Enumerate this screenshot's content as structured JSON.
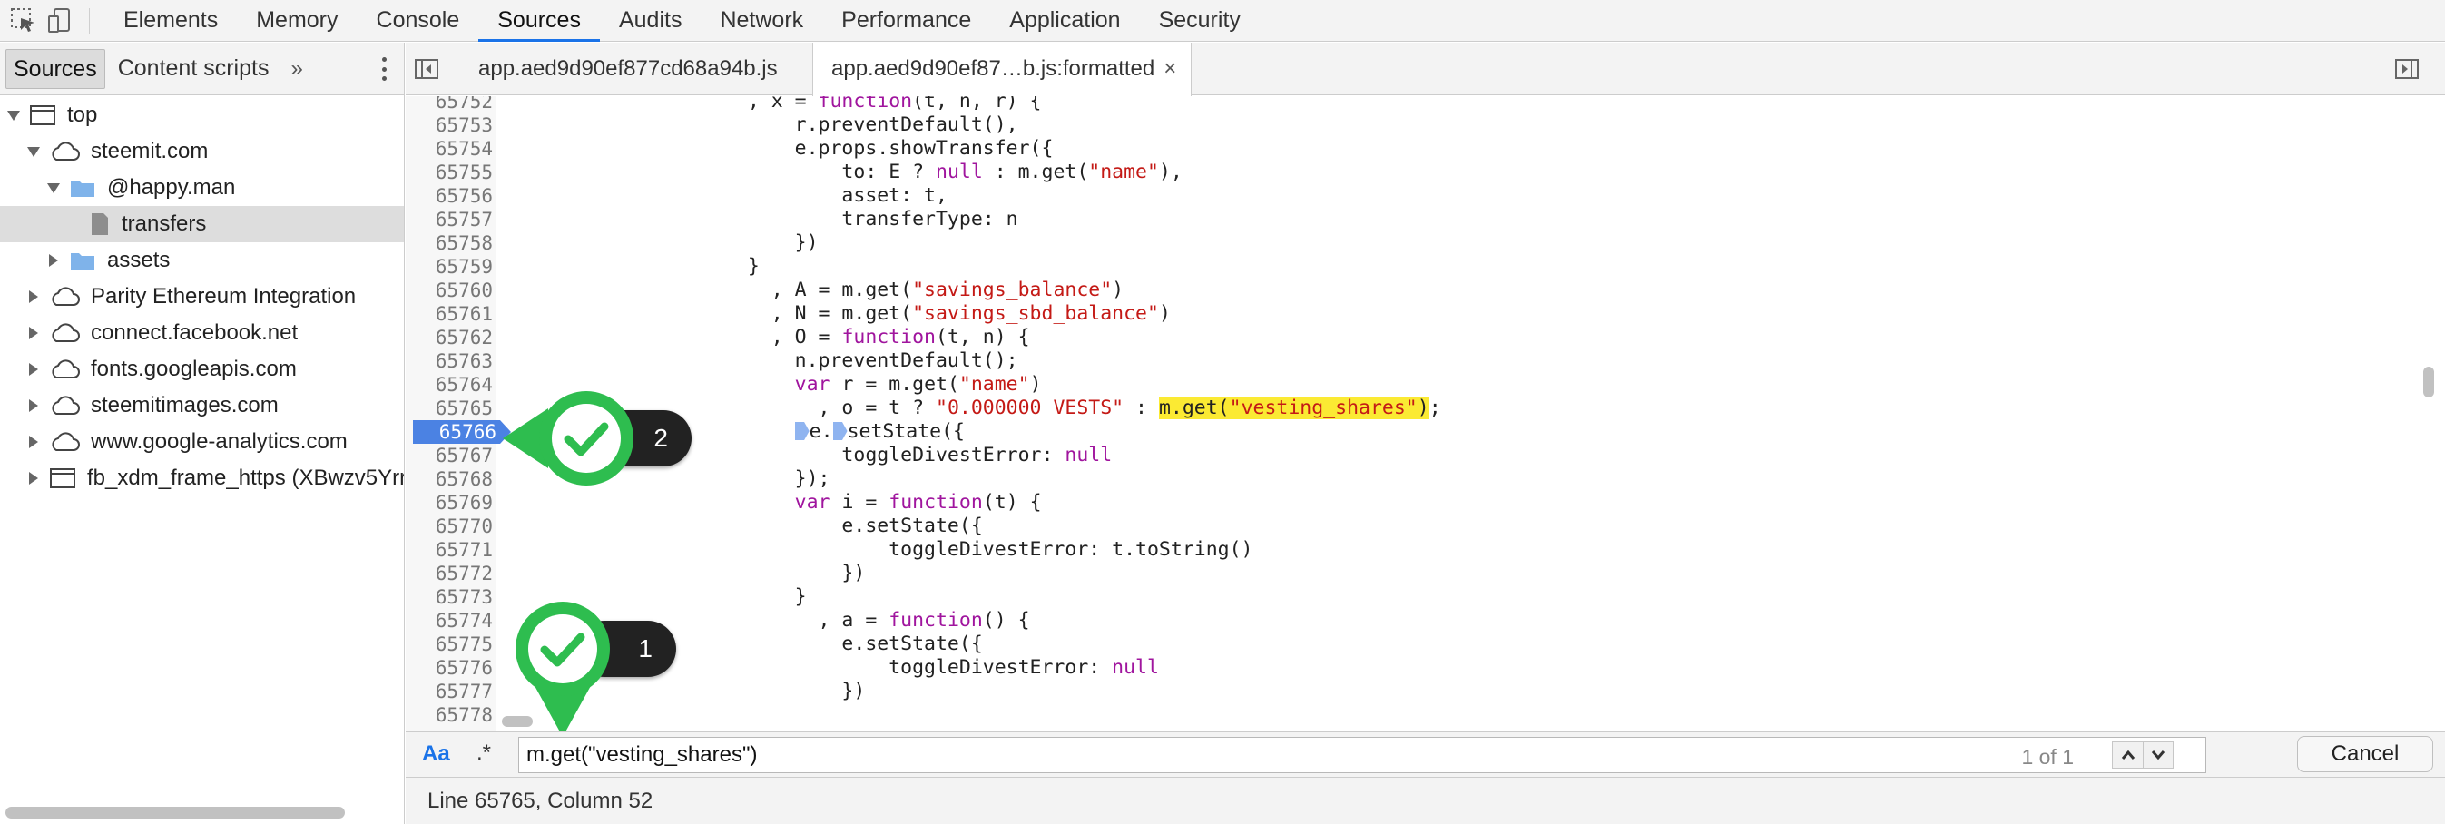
{
  "toolbar": {
    "icons": [
      "inspect-element-icon",
      "device-toggle-icon"
    ],
    "tabs": [
      "Elements",
      "Memory",
      "Console",
      "Sources",
      "Audits",
      "Network",
      "Performance",
      "Application",
      "Security"
    ],
    "active_tab": "Sources"
  },
  "navigator": {
    "tabs": [
      "Sources",
      "Content scripts"
    ],
    "active_tab": "Sources",
    "more": "»",
    "tree": [
      {
        "label": "top",
        "depth": 0,
        "expanded": true,
        "icon": "frame-icon"
      },
      {
        "label": "steemit.com",
        "depth": 1,
        "expanded": true,
        "icon": "cloud-icon"
      },
      {
        "label": "@happy.man",
        "depth": 2,
        "expanded": true,
        "icon": "folder-icon"
      },
      {
        "label": "transfers",
        "depth": 3,
        "icon": "file-icon",
        "selected": true
      },
      {
        "label": "assets",
        "depth": 2,
        "expanded": false,
        "icon": "folder-icon"
      },
      {
        "label": "Parity Ethereum Integration",
        "depth": 1,
        "expanded": false,
        "icon": "cloud-icon"
      },
      {
        "label": "connect.facebook.net",
        "depth": 1,
        "expanded": false,
        "icon": "cloud-icon"
      },
      {
        "label": "fonts.googleapis.com",
        "depth": 1,
        "expanded": false,
        "icon": "cloud-icon"
      },
      {
        "label": "steemitimages.com",
        "depth": 1,
        "expanded": false,
        "icon": "cloud-icon"
      },
      {
        "label": "www.google-analytics.com",
        "depth": 1,
        "expanded": false,
        "icon": "cloud-icon"
      },
      {
        "label": "fb_xdm_frame_https (XBwzv5Yrr",
        "depth": 1,
        "expanded": false,
        "icon": "frame-icon"
      }
    ]
  },
  "editor": {
    "tabs": [
      "app.aed9d90ef877cd68a94b.js",
      "app.aed9d90ef87…b.js:formatted"
    ],
    "active_tab": "app.aed9d90ef87…b.js:formatted",
    "close_symbol": "×",
    "line_numbers": [
      "65752",
      "65753",
      "65754",
      "65755",
      "65756",
      "65757",
      "65758",
      "65759",
      "65760",
      "65761",
      "65762",
      "65763",
      "65764",
      "65765",
      "65766",
      "65767",
      "65768",
      "65769",
      "65770",
      "65771",
      "65772",
      "65773",
      "65774",
      "65775",
      "65776",
      "65777",
      "65778"
    ],
    "breakpoint_line": "65766",
    "code_lines": [
      [
        {
          "t": "                    , x = "
        },
        {
          "t": "function",
          "c": "k"
        },
        {
          "t": "(t, n, r) {"
        }
      ],
      [
        {
          "t": "                        r.preventDefault(),"
        }
      ],
      [
        {
          "t": "                        e.props.showTransfer({"
        }
      ],
      [
        {
          "t": "                            to: E ? "
        },
        {
          "t": "null",
          "c": "k"
        },
        {
          "t": " : m.get("
        },
        {
          "t": "\"name\"",
          "c": "s"
        },
        {
          "t": "),"
        }
      ],
      [
        {
          "t": "                            asset: t,"
        }
      ],
      [
        {
          "t": "                            transferType: n"
        }
      ],
      [
        {
          "t": "                        })"
        }
      ],
      [
        {
          "t": "                    }"
        }
      ],
      [
        {
          "t": "                      , A = m.get("
        },
        {
          "t": "\"savings_balance\"",
          "c": "s"
        },
        {
          "t": ")"
        }
      ],
      [
        {
          "t": "                      , N = m.get("
        },
        {
          "t": "\"savings_sbd_balance\"",
          "c": "s"
        },
        {
          "t": ")"
        }
      ],
      [
        {
          "t": "                      , O = "
        },
        {
          "t": "function",
          "c": "k"
        },
        {
          "t": "(t, n) {"
        }
      ],
      [
        {
          "t": "                        n.preventDefault();"
        }
      ],
      [
        {
          "t": "                        "
        },
        {
          "t": "var",
          "c": "k"
        },
        {
          "t": " r = m.get("
        },
        {
          "t": "\"name\"",
          "c": "s"
        },
        {
          "t": ")"
        }
      ],
      [
        {
          "t": "                          , o = t ? "
        },
        {
          "t": "\"0.000000 VESTS\"",
          "c": "s"
        },
        {
          "t": " : "
        },
        {
          "t": "m.get(",
          "c": "hl"
        },
        {
          "t": "\"vesting_shares\"",
          "c": "hl s"
        },
        {
          "t": ")",
          "c": "hl"
        },
        {
          "t": ";"
        }
      ],
      [
        {
          "t": "                        ",
          "m": true
        },
        {
          "t": "e."
        },
        {
          "t": "",
          "m": true
        },
        {
          "t": "setState({"
        }
      ],
      [
        {
          "t": "                            toggleDivestError: "
        },
        {
          "t": "null",
          "c": "k"
        }
      ],
      [
        {
          "t": "                        });"
        }
      ],
      [
        {
          "t": "                        "
        },
        {
          "t": "var",
          "c": "k"
        },
        {
          "t": " i = "
        },
        {
          "t": "function",
          "c": "k"
        },
        {
          "t": "(t) {"
        }
      ],
      [
        {
          "t": "                            e.setState({"
        }
      ],
      [
        {
          "t": "                                toggleDivestError: t.toString()"
        }
      ],
      [
        {
          "t": "                            })"
        }
      ],
      [
        {
          "t": "                        }"
        }
      ],
      [
        {
          "t": "                          , a = "
        },
        {
          "t": "function",
          "c": "k"
        },
        {
          "t": "() {"
        }
      ],
      [
        {
          "t": "                            e.setState({"
        }
      ],
      [
        {
          "t": "                                toggleDivestError: "
        },
        {
          "t": "null",
          "c": "k"
        }
      ],
      [
        {
          "t": "                            })"
        }
      ],
      [
        {
          "t": ""
        }
      ]
    ]
  },
  "annotations": [
    {
      "label": "2",
      "color": "#2ebd4f",
      "icon": "checkmark-icon"
    },
    {
      "label": "1",
      "color": "#2ebd4f",
      "icon": "checkmark-icon"
    }
  ],
  "search": {
    "case_toggle": "Aa",
    "regex_toggle": ".*",
    "value": "m.get(\"vesting_shares\")",
    "match_count": "1 of 1",
    "cancel_label": "Cancel"
  },
  "status": {
    "text": "Line 65765, Column 52"
  }
}
